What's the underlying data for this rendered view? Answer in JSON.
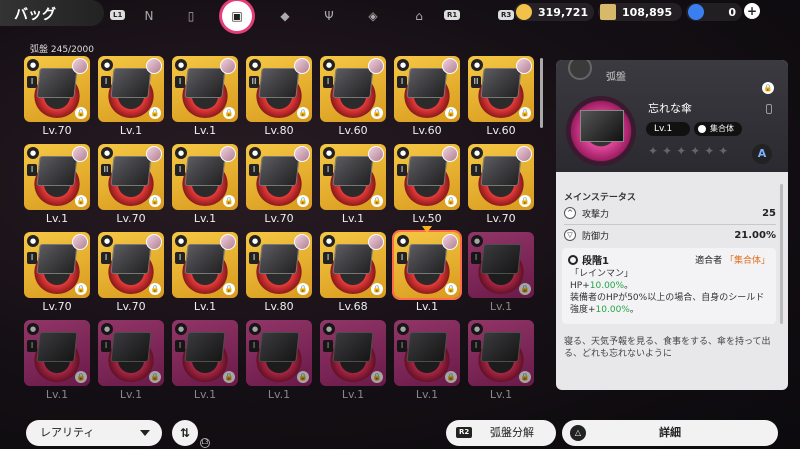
{
  "header": {
    "title": "バッグ",
    "l1": "L1",
    "r1": "R1",
    "r3": "R3",
    "tabs": [
      {
        "icon": "n-logo-icon"
      },
      {
        "icon": "handheld-icon"
      },
      {
        "icon": "disc-card-icon",
        "active": true
      },
      {
        "icon": "cube-icon"
      },
      {
        "icon": "fork-knife-icon"
      },
      {
        "icon": "package-icon"
      },
      {
        "icon": "house-icon"
      }
    ],
    "currencies": [
      {
        "name": "coin",
        "value": "319,721",
        "color": "#f2c14a"
      },
      {
        "name": "ticket",
        "value": "108,895",
        "color": "#d8b86a"
      },
      {
        "name": "gem",
        "value": "0",
        "color": "#3a7ff0"
      }
    ]
  },
  "grid": {
    "counter": "弧盤  245/2000",
    "cards": [
      {
        "tier": "gold",
        "level": "Lv.70",
        "mark": "I",
        "selected": false
      },
      {
        "tier": "gold",
        "level": "Lv.1",
        "mark": "I",
        "selected": false
      },
      {
        "tier": "gold",
        "level": "Lv.1",
        "mark": "I",
        "selected": false
      },
      {
        "tier": "gold",
        "level": "Lv.80",
        "mark": "II",
        "selected": false
      },
      {
        "tier": "gold",
        "level": "Lv.60",
        "mark": "I",
        "selected": false
      },
      {
        "tier": "gold",
        "level": "Lv.60",
        "mark": "I",
        "selected": false
      },
      {
        "tier": "gold",
        "level": "Lv.60",
        "mark": "II",
        "selected": false
      },
      {
        "tier": "gold",
        "level": "Lv.1",
        "mark": "I",
        "selected": false
      },
      {
        "tier": "gold",
        "level": "Lv.70",
        "mark": "II",
        "selected": false
      },
      {
        "tier": "gold",
        "level": "Lv.1",
        "mark": "I",
        "selected": false
      },
      {
        "tier": "gold",
        "level": "Lv.70",
        "mark": "I",
        "selected": false
      },
      {
        "tier": "gold",
        "level": "Lv.1",
        "mark": "I",
        "selected": false
      },
      {
        "tier": "gold",
        "level": "Lv.50",
        "mark": "I",
        "selected": false
      },
      {
        "tier": "gold",
        "level": "Lv.70",
        "mark": "I",
        "selected": false
      },
      {
        "tier": "gold",
        "level": "Lv.70",
        "mark": "I",
        "selected": false
      },
      {
        "tier": "gold",
        "level": "Lv.70",
        "mark": "I",
        "selected": false
      },
      {
        "tier": "gold",
        "level": "Lv.1",
        "mark": "I",
        "selected": false
      },
      {
        "tier": "gold",
        "level": "Lv.80",
        "mark": "I",
        "selected": false
      },
      {
        "tier": "gold",
        "level": "Lv.68",
        "mark": "I",
        "selected": false
      },
      {
        "tier": "gold",
        "level": "Lv.1",
        "mark": "I",
        "selected": true
      },
      {
        "tier": "pink",
        "level": "Lv.1",
        "mark": "I",
        "selected": false
      },
      {
        "tier": "pink",
        "level": "Lv.1",
        "mark": "I",
        "selected": false
      },
      {
        "tier": "pink",
        "level": "Lv.1",
        "mark": "I",
        "selected": false
      },
      {
        "tier": "pink",
        "level": "Lv.1",
        "mark": "I",
        "selected": false
      },
      {
        "tier": "pink",
        "level": "Lv.1",
        "mark": "I",
        "selected": false
      },
      {
        "tier": "pink",
        "level": "Lv.1",
        "mark": "I",
        "selected": false
      },
      {
        "tier": "pink",
        "level": "Lv.1",
        "mark": "I",
        "selected": false
      },
      {
        "tier": "pink",
        "level": "Lv.1",
        "mark": "I",
        "selected": false
      }
    ]
  },
  "detail": {
    "category": "弧盤",
    "name": "忘れな傘",
    "level": "Lv.1",
    "attribute": "集合体",
    "stars": "✦✦✦✦✦✦",
    "rank": "A",
    "main_stats_title": "メインステータス",
    "stats": [
      {
        "label": "攻撃力",
        "value": "25",
        "icon": "attack-icon"
      },
      {
        "label": "防御力",
        "value": "21.00%",
        "icon": "defense-icon"
      }
    ],
    "effect": {
      "stage": "段階1",
      "match_label": "適合者",
      "match_value": "「集合体」",
      "name": "「レインマン」",
      "hp_prefix": "HP+",
      "hp_value": "10.00%",
      "hp_suffix": "。",
      "cond": "装備者のHPが50%以上の場合、自身のシールド強度+",
      "cond_value": "10.00%",
      "cond_suffix": "。"
    },
    "flavor": "寝る、天気予報を見る、食事をする、傘を持って出る、どれも忘れないように"
  },
  "bottom": {
    "sort_label": "レアリティ",
    "decompose_key": "R2",
    "decompose_label": "弧盤分解",
    "detail_key": "△",
    "detail_label": "詳細",
    "order_sub": "L3"
  }
}
